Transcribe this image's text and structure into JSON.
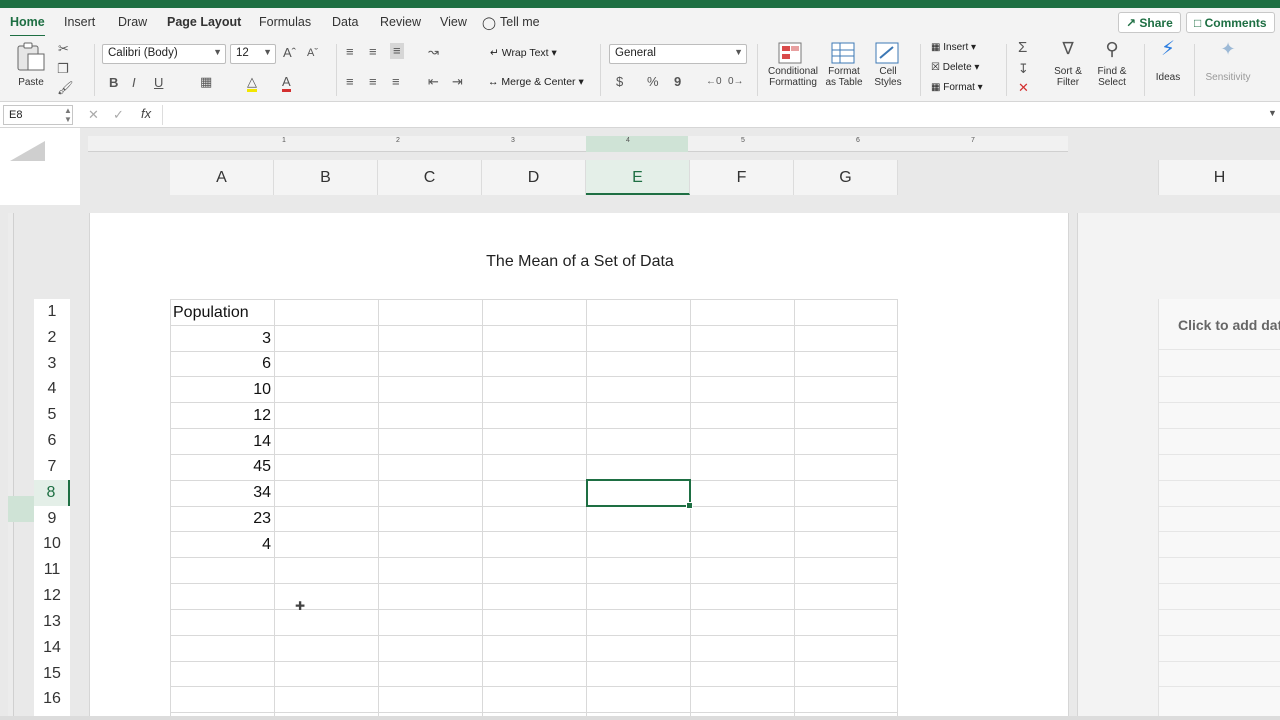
{
  "tabs": [
    {
      "label": "Home",
      "active": true
    },
    {
      "label": "Insert"
    },
    {
      "label": "Draw"
    },
    {
      "label": "Page Layout"
    },
    {
      "label": "Formulas"
    },
    {
      "label": "Data"
    },
    {
      "label": "Review"
    },
    {
      "label": "View"
    },
    {
      "label": "Tell me"
    }
  ],
  "header_buttons": {
    "share": "Share",
    "comments": "Comments"
  },
  "ribbon": {
    "paste": "Paste",
    "font_name": "Calibri (Body)",
    "font_size": "12",
    "bold": "B",
    "italic": "I",
    "underline": "U",
    "wrap_text": "Wrap Text",
    "merge_center": "Merge & Center",
    "number_format": "General",
    "currency": "$",
    "percent": "%",
    "comma": "9",
    "conditional_formatting": [
      "Conditional",
      "Formatting"
    ],
    "format_as_table": [
      "Format",
      "as Table"
    ],
    "cell_styles": [
      "Cell",
      "Styles"
    ],
    "insert": "Insert",
    "delete": "Delete",
    "format": "Format",
    "sort_filter": [
      "Sort &",
      "Filter"
    ],
    "find_select": [
      "Find &",
      "Select"
    ],
    "ideas": "Ideas",
    "sensitivity": "Sensitivity"
  },
  "formula_bar": {
    "name_box": "E8",
    "fx": "fx",
    "formula": ""
  },
  "ruler_numbers": [
    "1",
    "2",
    "3",
    "4",
    "5",
    "6",
    "7"
  ],
  "columns": [
    "A",
    "B",
    "C",
    "D",
    "E",
    "F",
    "G"
  ],
  "selected_column": "E",
  "extra_column": "H",
  "rows": [
    "1",
    "2",
    "3",
    "4",
    "5",
    "6",
    "7",
    "8",
    "9",
    "10",
    "11",
    "12",
    "13",
    "14",
    "15",
    "16"
  ],
  "selected_row": "8",
  "sheet_title": "The Mean of a Set of Data",
  "cells_A": [
    "Population",
    "3",
    "6",
    "10",
    "12",
    "14",
    "45",
    "34",
    "23",
    "4"
  ],
  "right_pane_text": "Click to add data",
  "colors": {
    "accent": "#1e6f43",
    "selection_bg": "#e4efe8"
  }
}
